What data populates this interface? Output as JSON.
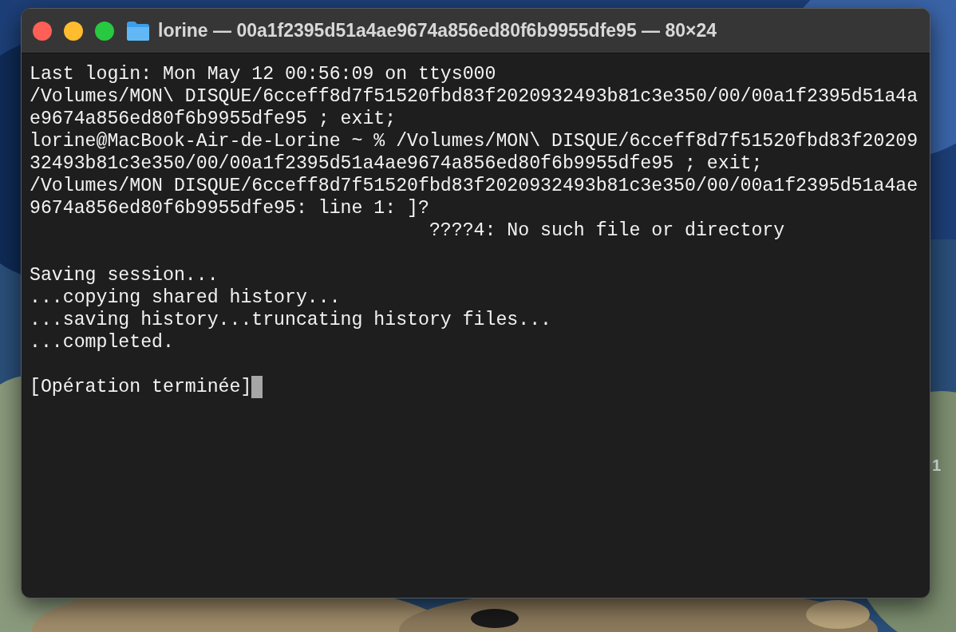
{
  "desktop": {
    "label": "1"
  },
  "window": {
    "title": "lorine — 00a1f2395d51a4ae9674a856ed80f6b9955dfe95 — 80×24",
    "lines": [
      {
        "kind": "text",
        "text": "Last login: Mon May 12 00:56:09 on ttys000"
      },
      {
        "kind": "text",
        "text": "/Volumes/MON\\ DISQUE/6cceff8d7f51520fbd83f2020932493b81c3e350/00/00a1f2395d51a4a"
      },
      {
        "kind": "text",
        "text": "e9674a856ed80f6b9955dfe95 ; exit;"
      },
      {
        "kind": "text",
        "text": "lorine@MacBook-Air-de-Lorine ~ % /Volumes/MON\\ DISQUE/6cceff8d7f51520fbd83f20209"
      },
      {
        "kind": "text",
        "text": "32493b81c3e350/00/00a1f2395d51a4ae9674a856ed80f6b9955dfe95 ; exit;"
      },
      {
        "kind": "text",
        "text": "/Volumes/MON DISQUE/6cceff8d7f51520fbd83f2020932493b81c3e350/00/00a1f2395d51a4ae"
      },
      {
        "kind": "text",
        "text": "9674a856ed80f6b9955dfe95: line 1: ]?"
      },
      {
        "kind": "text",
        "text": "                                    ????4: No such file or directory"
      },
      {
        "kind": "blank"
      },
      {
        "kind": "text",
        "text": "Saving session..."
      },
      {
        "kind": "text",
        "text": "...copying shared history..."
      },
      {
        "kind": "text",
        "text": "...saving history...truncating history files..."
      },
      {
        "kind": "text",
        "text": "...completed."
      },
      {
        "kind": "blank"
      },
      {
        "kind": "prompt",
        "text": "[Opération terminée]"
      }
    ]
  }
}
